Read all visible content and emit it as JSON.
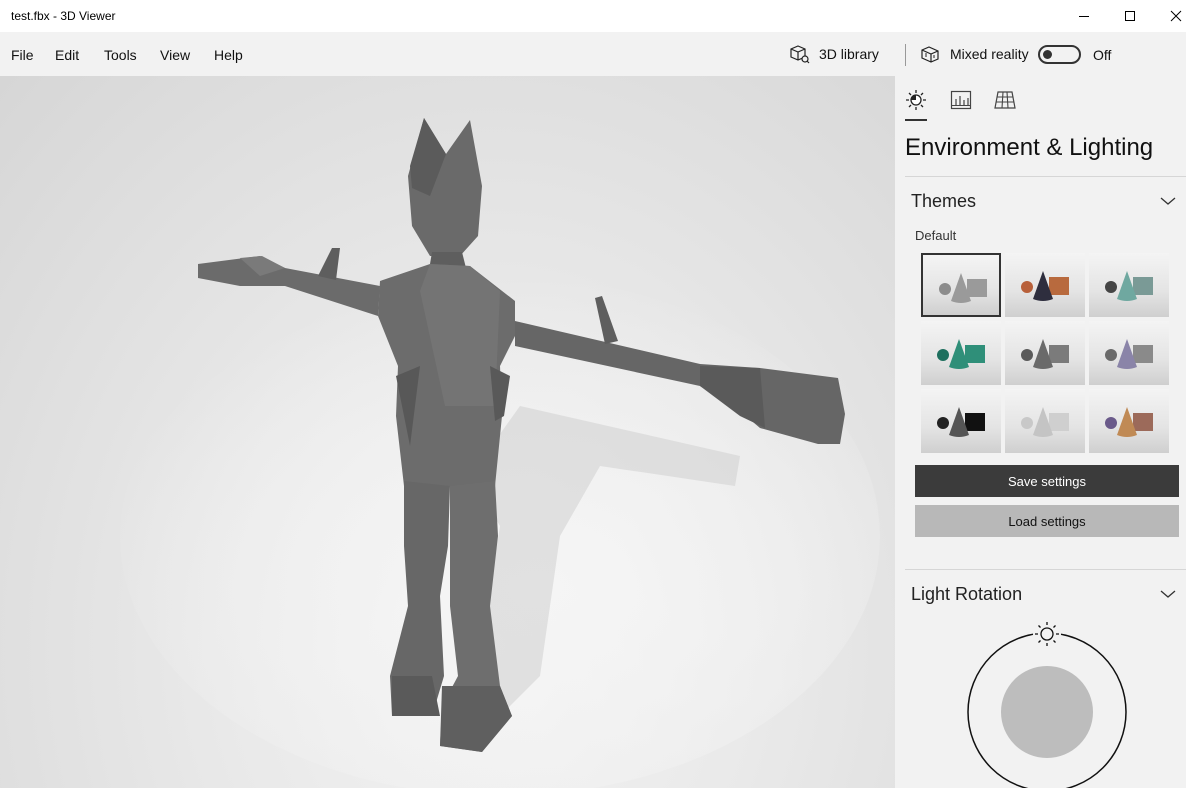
{
  "window": {
    "title": "test.fbx - 3D Viewer"
  },
  "menu": {
    "items": [
      "File",
      "Edit",
      "Tools",
      "View",
      "Help"
    ],
    "library_label": "3D library",
    "mixed_reality_label": "Mixed reality",
    "mixed_reality_state": "Off"
  },
  "panel": {
    "tabs": [
      "sun-icon",
      "stats-icon",
      "grid-icon"
    ],
    "title": "Environment & Lighting",
    "themes": {
      "heading": "Themes",
      "default_label": "Default",
      "save_label": "Save settings",
      "load_label": "Load settings",
      "swatches": [
        {
          "name": "theme-grey",
          "cone": "#9a9a9a",
          "box": "#9a9a9a",
          "sphere": "#8c8c8c",
          "selected": true
        },
        {
          "name": "theme-dusk",
          "cone": "#2e2e3e",
          "box": "#b86a3e",
          "sphere": "#b8603a",
          "selected": false
        },
        {
          "name": "theme-teal",
          "cone": "#6fa8a0",
          "box": "#7a9a96",
          "sphere": "#444",
          "selected": false
        },
        {
          "name": "theme-green",
          "cone": "#2f8f79",
          "box": "#2f8f79",
          "sphere": "#1e6f5e",
          "selected": false
        },
        {
          "name": "theme-slate",
          "cone": "#6a6a6a",
          "box": "#7b7b7b",
          "sphere": "#5a5a5a",
          "selected": false
        },
        {
          "name": "theme-violet",
          "cone": "#8a84a8",
          "box": "#8a8a8a",
          "sphere": "#6a6a6a",
          "selected": false
        },
        {
          "name": "theme-contrast",
          "cone": "#555",
          "box": "#111",
          "sphere": "#222",
          "selected": false
        },
        {
          "name": "theme-light",
          "cone": "#c4c4c4",
          "box": "#cfcfcf",
          "sphere": "#c8c8c8",
          "selected": false
        },
        {
          "name": "theme-warm",
          "cone": "#c08a55",
          "box": "#9c6a5a",
          "sphere": "#6a5a8a",
          "selected": false
        }
      ]
    },
    "light_rotation": {
      "heading": "Light Rotation"
    }
  }
}
